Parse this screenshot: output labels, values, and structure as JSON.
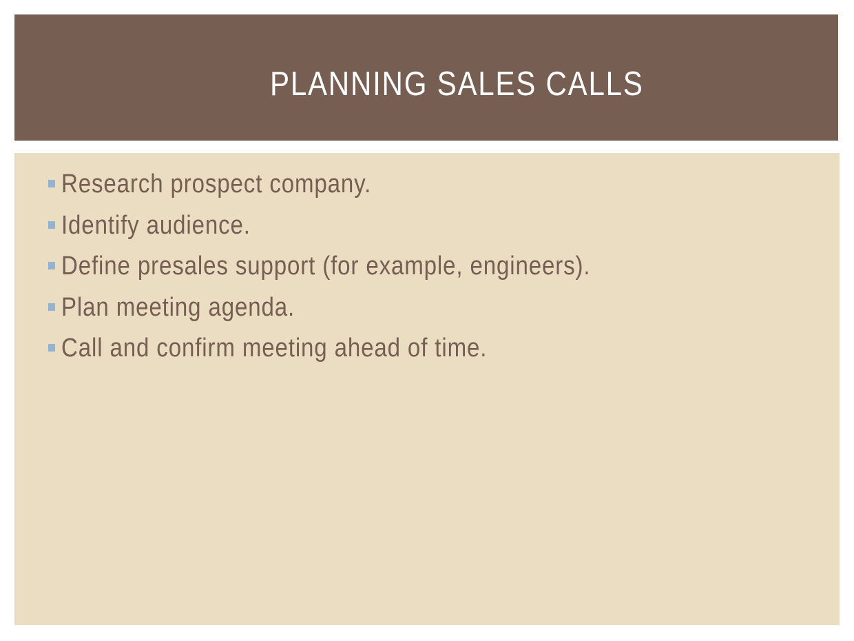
{
  "slide": {
    "title": "PLANNING SALES CALLS",
    "bullets": [
      "Research prospect company.",
      "Identify audience.",
      "Define presales support (for example, engineers).",
      "Plan meeting agenda.",
      "Call and confirm meeting ahead of time."
    ],
    "colors": {
      "title_band": "#775e53",
      "content_panel": "#eaddc2",
      "bullet_marker": "#93b3d3",
      "body_text": "#775e53",
      "title_text": "#ffffff"
    }
  }
}
